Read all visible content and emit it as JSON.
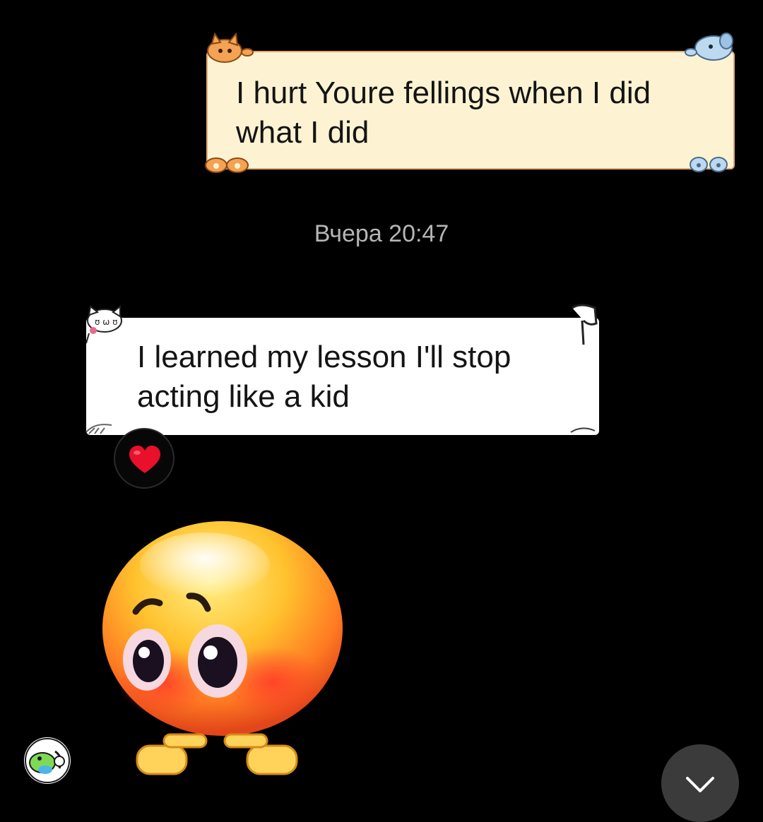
{
  "messages": {
    "outgoing": {
      "text": "I hurt Youre fellings when I did what I did"
    },
    "timestamp": "Вчера 20:47",
    "incoming": {
      "text": "I learned my lesson I'll stop acting like a kid",
      "reaction": "heart"
    },
    "sticker": "shy-emoji-pointing-fingers-sticker"
  },
  "controls": {
    "scroll_down_icon": "chevron-down-icon"
  },
  "colors": {
    "background": "#000000",
    "outgoing_bubble": "#fdf3d2",
    "outgoing_border": "#e0a86e",
    "incoming_bubble": "#ffffff",
    "timestamp_text": "#b5b5b5",
    "reaction_heart": "#e8102a",
    "scroll_button": "#3b3b3b"
  }
}
